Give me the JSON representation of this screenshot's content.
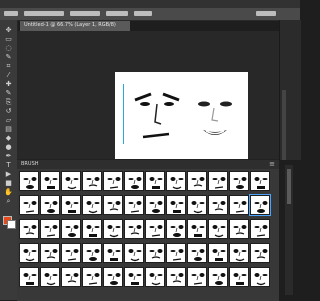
{
  "window": {
    "doc_tab_label": "Untitled-1 @ 66.7% (Layer 1, RGB/8)"
  },
  "tools": [
    {
      "icon": "move-icon"
    },
    {
      "icon": "marquee-icon"
    },
    {
      "icon": "lasso-icon"
    },
    {
      "icon": "quick-select-icon"
    },
    {
      "icon": "crop-icon"
    },
    {
      "icon": "eyedropper-icon"
    },
    {
      "icon": "healing-icon"
    },
    {
      "icon": "brush-icon"
    },
    {
      "icon": "clone-icon"
    },
    {
      "icon": "history-brush-icon"
    },
    {
      "icon": "eraser-icon"
    },
    {
      "icon": "gradient-icon"
    },
    {
      "icon": "blur-icon"
    },
    {
      "icon": "dodge-icon"
    },
    {
      "icon": "pen-icon"
    },
    {
      "icon": "type-icon"
    },
    {
      "icon": "path-select-icon"
    },
    {
      "icon": "shape-icon"
    },
    {
      "icon": "hand-icon"
    },
    {
      "icon": "zoom-icon"
    }
  ],
  "colors": {
    "foreground": "#e64a19",
    "background": "#ffffff",
    "accent": "#29a9d6"
  },
  "panel": {
    "title": "BRUSH",
    "menu_icon": "panel-menu-icon"
  }
}
